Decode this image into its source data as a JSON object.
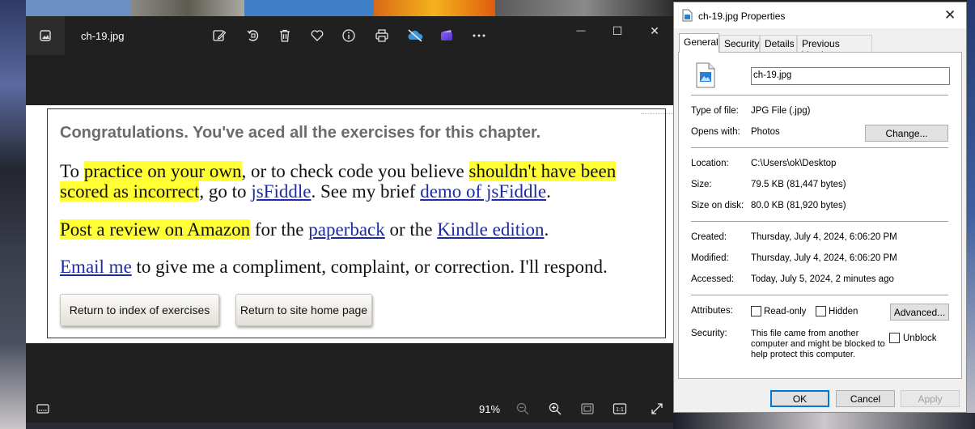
{
  "photos": {
    "filename": "ch-19.jpg",
    "zoom": "91%",
    "toolbar_icons": [
      "edit-icon",
      "rotate-icon",
      "delete-icon",
      "favorite-icon",
      "info-icon",
      "print-icon",
      "onedrive-icon",
      "clipchamp-icon",
      "more-icon"
    ],
    "window_controls": {
      "minimize": "—",
      "maximize": "☐",
      "close": "✕"
    }
  },
  "webpage": {
    "heading": "Congratulations. You've aced all the exercises for this chapter.",
    "p1": {
      "t1": "To ",
      "h1": "practice on your own",
      "t2": ", or to check code you believe ",
      "h2": "shouldn't have been",
      "h3": "scored as incorrect",
      "t3": ", go to ",
      "link1": "jsFiddle",
      "t4": ". See my brief ",
      "link2": "demo of jsFiddle",
      "t5": "."
    },
    "p2": {
      "h1": "Post a review on Amazon",
      "t1": " for the ",
      "link1": "paperback",
      "t2": " or the ",
      "link2": "Kindle edition",
      "t3": "."
    },
    "p3": {
      "link1": "Email me",
      "t1": " to give me a compliment, complaint, or correction. I'll respond."
    },
    "buttons": {
      "index": "Return to index of exercises",
      "home": "Return to site home page"
    }
  },
  "properties": {
    "title": "ch-19.jpg Properties",
    "close": "✕",
    "tabs": [
      "General",
      "Security",
      "Details",
      "Previous Versions"
    ],
    "active_tab": "General",
    "filename_field": "ch-19.jpg",
    "type_label": "Type of file:",
    "type_value": "JPG File (.jpg)",
    "opens_label": "Opens with:",
    "opens_value": "Photos",
    "change_button": "Change...",
    "location_label": "Location:",
    "location_value": "C:\\Users\\ok\\Desktop",
    "size_label": "Size:",
    "size_value": "79.5 KB (81,447 bytes)",
    "size_disk_label": "Size on disk:",
    "size_disk_value": "80.0 KB (81,920 bytes)",
    "created_label": "Created:",
    "created_value": "Thursday, July 4, 2024, 6:06:20 PM",
    "modified_label": "Modified:",
    "modified_value": "Thursday, July 4, 2024, 6:06:20 PM",
    "accessed_label": "Accessed:",
    "accessed_value": "Today, July 5, 2024, 2 minutes ago",
    "attributes_label": "Attributes:",
    "readonly_label": "Read-only",
    "hidden_label": "Hidden",
    "advanced_button": "Advanced...",
    "security_label": "Security:",
    "security_line1": "This file came from another",
    "security_line2": "computer and might be blocked to",
    "security_line3": "help protect this computer.",
    "unblock_label": "Unblock",
    "ok_button": "OK",
    "cancel_button": "Cancel",
    "apply_button": "Apply",
    "accent_color": "#0078d7"
  }
}
